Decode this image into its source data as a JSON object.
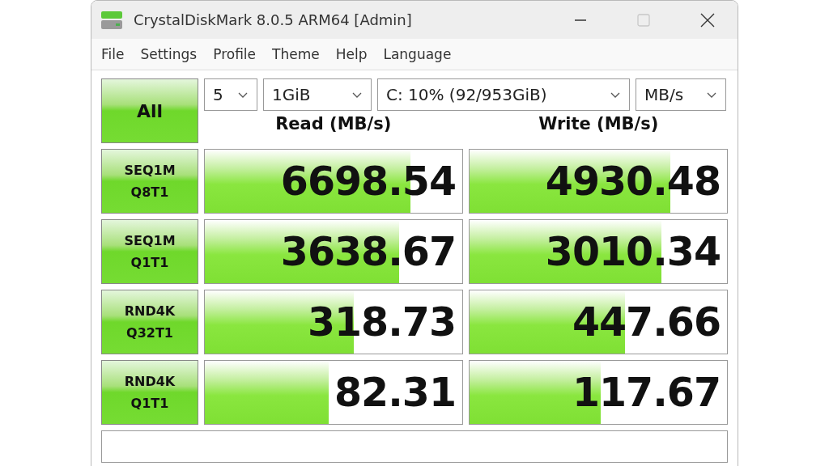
{
  "window": {
    "title": "CrystalDiskMark 8.0.5 ARM64 [Admin]"
  },
  "menu": [
    "File",
    "Settings",
    "Profile",
    "Theme",
    "Help",
    "Language"
  ],
  "all_button": "All",
  "selectors": [
    {
      "value": "5"
    },
    {
      "value": "1GiB"
    },
    {
      "value": "C: 10% (92/953GiB)"
    },
    {
      "value": "MB/s"
    }
  ],
  "columns": [
    "Read (MB/s)",
    "Write (MB/s)"
  ],
  "rows": [
    {
      "test": [
        "SEQ1M",
        "Q8T1"
      ],
      "read": {
        "value": "6698.54",
        "level": 0.8
      },
      "write": {
        "value": "4930.48",
        "level": 0.78
      }
    },
    {
      "test": [
        "SEQ1M",
        "Q1T1"
      ],
      "read": {
        "value": "3638.67",
        "level": 0.755
      },
      "write": {
        "value": "3010.34",
        "level": 0.745
      }
    },
    {
      "test": [
        "RND4K",
        "Q32T1"
      ],
      "read": {
        "value": "318.73",
        "level": 0.58
      },
      "write": {
        "value": "447.66",
        "level": 0.605
      }
    },
    {
      "test": [
        "RND4K",
        "Q1T1"
      ],
      "read": {
        "value": "82.31",
        "level": 0.48
      },
      "write": {
        "value": "117.67",
        "level": 0.51
      }
    }
  ]
}
